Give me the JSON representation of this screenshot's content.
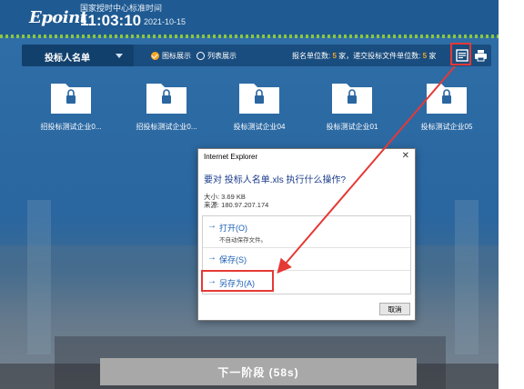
{
  "header": {
    "logo": "Epoint",
    "time_caption": "国家授时中心标准时间",
    "clock": "11:03:10",
    "date": "2021-10-15"
  },
  "toolbar": {
    "dropdown_label": "投标人名单",
    "view_icon_label": "图标展示",
    "view_list_label": "列表展示",
    "count_prefix": "报名单位数:",
    "registered_count": "5",
    "count_mid": "家，递交投标文件单位数:",
    "submitted_count": "5",
    "count_suffix": "家",
    "export_icon": "export-list-icon",
    "print_icon": "print-icon"
  },
  "folders": [
    {
      "name": "招投标测试企业0..."
    },
    {
      "name": "招投标测试企业0..."
    },
    {
      "name": "投标测试企业04"
    },
    {
      "name": "投标测试企业01"
    },
    {
      "name": "投标测试企业05"
    }
  ],
  "dialog": {
    "title": "Internet Explorer",
    "close": "✕",
    "question": "要对 投标人名单.xls 执行什么操作?",
    "size": "大小: 3.69 KB",
    "source": "来源: 180.97.207.174",
    "open_label": "打开(O)",
    "open_sub": "不自动保存文件。",
    "save_label": "保存(S)",
    "saveas_label": "另存为(A)",
    "cancel_label": "取消",
    "arrow": "→"
  },
  "next_button": "下一阶段 (58s)",
  "colors": {
    "accent": "#f5a623",
    "annotation_red": "#e53935",
    "link_blue": "#1a5fb4"
  }
}
